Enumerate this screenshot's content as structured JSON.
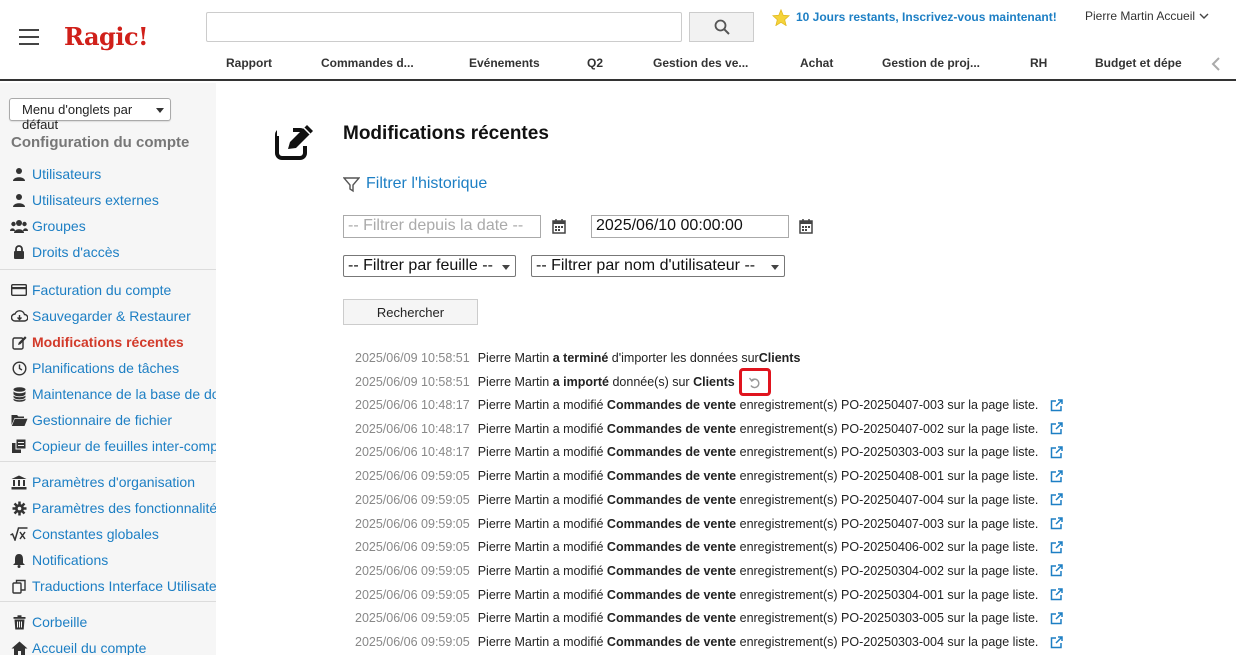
{
  "header": {
    "logo": "Ragic!",
    "search_placeholder": "",
    "trial_text": "10 Jours restants, Inscrivez-vous maintenant!",
    "user_name": "Pierre Martin Accueil",
    "tabs": [
      "Rapport",
      "Commandes d...",
      "Evénements",
      "Q2",
      "Gestion des ve...",
      "Achat",
      "Gestion de proj...",
      "RH",
      "Budget et dépe"
    ]
  },
  "sidebar": {
    "tab_menu_select": "Menu d'onglets par défaut",
    "heading": "Configuration du compte",
    "groups": [
      [
        {
          "label": "Utilisateurs",
          "icon": "user-icon"
        },
        {
          "label": "Utilisateurs externes",
          "icon": "user-icon"
        },
        {
          "label": "Groupes",
          "icon": "users-icon"
        },
        {
          "label": "Droits d'accès",
          "icon": "lock-icon"
        }
      ],
      [
        {
          "label": "Facturation du compte",
          "icon": "credit-card-icon"
        },
        {
          "label": "Sauvegarder & Restaurer",
          "icon": "cloud-download-icon"
        },
        {
          "label": "Modifications récentes",
          "icon": "edit-icon",
          "active": true
        },
        {
          "label": "Planifications de tâches",
          "icon": "clock-icon"
        },
        {
          "label": "Maintenance de la base de données",
          "icon": "database-icon"
        },
        {
          "label": "Gestionnaire de fichier",
          "icon": "folder-icon"
        },
        {
          "label": "Copieur de feuilles inter-comptes",
          "icon": "copy-sheets-icon"
        }
      ],
      [
        {
          "label": "Paramètres d'organisation",
          "icon": "institution-icon"
        },
        {
          "label": "Paramètres des fonctionnalités",
          "icon": "gear-icon"
        },
        {
          "label": "Constantes globales",
          "icon": "sqrt-icon"
        },
        {
          "label": "Notifications",
          "icon": "bell-icon"
        },
        {
          "label": "Traductions Interface Utilisateur",
          "icon": "copy-icon"
        }
      ],
      [
        {
          "label": "Corbeille",
          "icon": "trash-icon"
        },
        {
          "label": "Accueil du compte",
          "icon": "home-icon"
        }
      ]
    ]
  },
  "main": {
    "title": "Modifications récentes",
    "filter_link": "Filtrer l'historique",
    "date_from_placeholder": "-- Filtrer depuis la date --",
    "date_to_value": "2025/06/10 00:00:00",
    "sheet_filter": "-- Filtrer par feuille --",
    "user_filter": "-- Filtrer par nom d'utilisateur --",
    "search_button": "Rechercher",
    "log": [
      {
        "ts": "2025/06/09 10:58:51",
        "pre": "Pierre Martin ",
        "bold1": "a terminé",
        "mid": " d'importer les données sur",
        "bold2": "Clients",
        "post": "",
        "action": "none"
      },
      {
        "ts": "2025/06/09 10:58:51",
        "pre": "Pierre Martin ",
        "bold1": "a importé",
        "mid": " donnée(s) sur ",
        "bold2": "Clients",
        "post": "",
        "action": "undo"
      },
      {
        "ts": "2025/06/06 10:48:17",
        "pre": "Pierre Martin a modifié ",
        "bold1": "Commandes de vente",
        "mid": " enregistrement(s) PO-20250407-003 sur la page liste.",
        "bold2": "",
        "post": "",
        "action": "link"
      },
      {
        "ts": "2025/06/06 10:48:17",
        "pre": "Pierre Martin a modifié ",
        "bold1": "Commandes de vente",
        "mid": " enregistrement(s) PO-20250407-002 sur la page liste.",
        "bold2": "",
        "post": "",
        "action": "link"
      },
      {
        "ts": "2025/06/06 10:48:17",
        "pre": "Pierre Martin a modifié ",
        "bold1": "Commandes de vente",
        "mid": " enregistrement(s) PO-20250303-003 sur la page liste.",
        "bold2": "",
        "post": "",
        "action": "link"
      },
      {
        "ts": "2025/06/06 09:59:05",
        "pre": "Pierre Martin a modifié ",
        "bold1": "Commandes de vente",
        "mid": " enregistrement(s) PO-20250408-001 sur la page liste.",
        "bold2": "",
        "post": "",
        "action": "link"
      },
      {
        "ts": "2025/06/06 09:59:05",
        "pre": "Pierre Martin a modifié ",
        "bold1": "Commandes de vente",
        "mid": " enregistrement(s) PO-20250407-004 sur la page liste.",
        "bold2": "",
        "post": "",
        "action": "link"
      },
      {
        "ts": "2025/06/06 09:59:05",
        "pre": "Pierre Martin a modifié ",
        "bold1": "Commandes de vente",
        "mid": " enregistrement(s) PO-20250407-003 sur la page liste.",
        "bold2": "",
        "post": "",
        "action": "link"
      },
      {
        "ts": "2025/06/06 09:59:05",
        "pre": "Pierre Martin a modifié ",
        "bold1": "Commandes de vente",
        "mid": " enregistrement(s) PO-20250406-002 sur la page liste.",
        "bold2": "",
        "post": "",
        "action": "link"
      },
      {
        "ts": "2025/06/06 09:59:05",
        "pre": "Pierre Martin a modifié ",
        "bold1": "Commandes de vente",
        "mid": " enregistrement(s) PO-20250304-002 sur la page liste.",
        "bold2": "",
        "post": "",
        "action": "link"
      },
      {
        "ts": "2025/06/06 09:59:05",
        "pre": "Pierre Martin a modifié ",
        "bold1": "Commandes de vente",
        "mid": " enregistrement(s) PO-20250304-001 sur la page liste.",
        "bold2": "",
        "post": "",
        "action": "link"
      },
      {
        "ts": "2025/06/06 09:59:05",
        "pre": "Pierre Martin a modifié ",
        "bold1": "Commandes de vente",
        "mid": " enregistrement(s) PO-20250303-005 sur la page liste.",
        "bold2": "",
        "post": "",
        "action": "link"
      },
      {
        "ts": "2025/06/06 09:59:05",
        "pre": "Pierre Martin a modifié ",
        "bold1": "Commandes de vente",
        "mid": " enregistrement(s) PO-20250303-004 sur la page liste.",
        "bold2": "",
        "post": "",
        "action": "link"
      }
    ]
  },
  "colors": {
    "brand": "#d0201a",
    "link": "#1d7fc4",
    "active": "#d23a2a",
    "highlight": "#e0141e"
  }
}
